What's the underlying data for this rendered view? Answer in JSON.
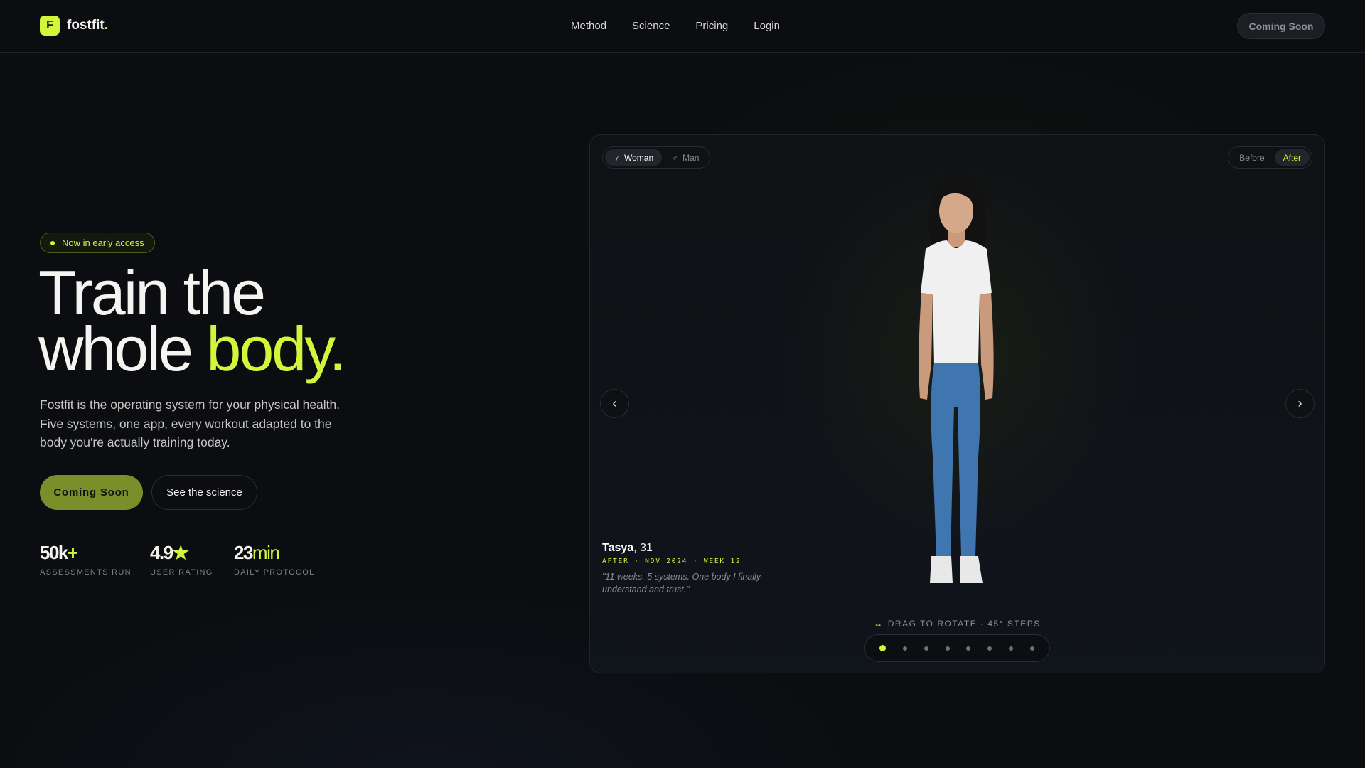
{
  "nav": {
    "brand": "fostfit",
    "brand_dot": ".",
    "logo_glyph": "F",
    "links": [
      "Method",
      "Science",
      "Pricing",
      "Login"
    ],
    "cta": "Coming Soon"
  },
  "hero": {
    "badge": "Now in early access",
    "title_line1": "Train the",
    "title_line2_a": "whole ",
    "title_line2_b": "body.",
    "description": "Fostfit is the operating system for your physical health. Five systems, one app, every workout adapted to the body you're actually training today.",
    "primary_cta": "Coming Soon",
    "secondary_cta": "See the science",
    "stats": [
      {
        "value": "50k",
        "suffix": "+",
        "label": "ASSESSMENTS RUN"
      },
      {
        "value": "4.9",
        "suffix": "★",
        "label": "USER RATING"
      },
      {
        "value": "23",
        "suffix": "min",
        "label": "DAILY PROTOCOL"
      }
    ]
  },
  "viewer": {
    "gender_options": [
      {
        "icon": "♀",
        "label": "Woman"
      },
      {
        "icon": "♂",
        "label": "Man"
      }
    ],
    "selected_gender": "Woman",
    "phase_options": [
      "Before",
      "After"
    ],
    "selected_phase": "After",
    "name": "Tasya",
    "age": ", 31",
    "meta": "AFTER · NOV 2024 · WEEK 12",
    "quote": "\"11 weeks. 5 systems. One body I finally understand and trust.\"",
    "drag_icon": "↔",
    "drag_hint": "DRAG TO ROTATE · 45° STEPS",
    "rotation_steps": 8,
    "active_step": 1
  },
  "colors": {
    "accent": "#d4f53c",
    "primary_button": "#7a8f2a",
    "background": "#0b0d10"
  }
}
